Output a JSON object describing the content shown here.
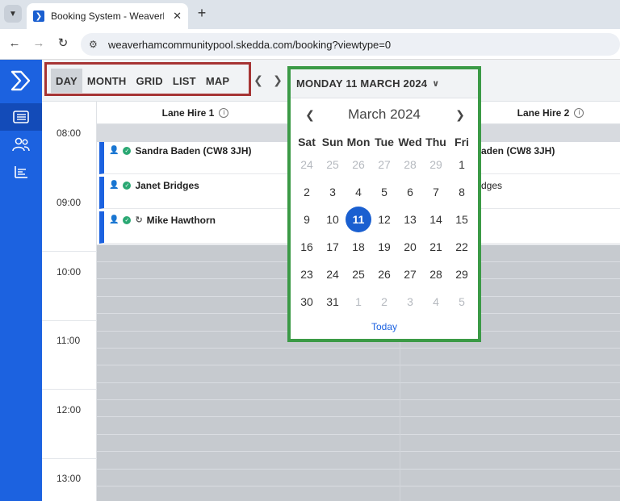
{
  "browser": {
    "tab_title": "Booking System - Weaverham C",
    "url": "weaverhamcommunitypool.skedda.com/booking?viewtype=0"
  },
  "toolbar": {
    "views": [
      {
        "label": "DAY",
        "active": true
      },
      {
        "label": "MONTH",
        "active": false
      },
      {
        "label": "GRID",
        "active": false
      },
      {
        "label": "LIST",
        "active": false
      },
      {
        "label": "MAP",
        "active": false
      }
    ],
    "date_label": "MONDAY 11 MARCH 2024"
  },
  "columns": [
    {
      "label": "Lane Hire 1"
    },
    {
      "label": "Lane Hire 2"
    }
  ],
  "times": [
    "08:00",
    "09:00",
    "10:00",
    "11:00",
    "12:00",
    "13:00"
  ],
  "bookings_lane1": [
    {
      "name": "Sandra Baden (CW8 3JH)",
      "recurring": false
    },
    {
      "name": "Janet Bridges",
      "recurring": false
    },
    {
      "name": "Mike Hawthorn",
      "recurring": true
    }
  ],
  "bookings_lane2_visible": [
    {
      "name": "aden (CW8 3JH)"
    },
    {
      "name": "dges"
    }
  ],
  "calendar": {
    "month_label": "March 2024",
    "days_of_week": [
      "Sat",
      "Sun",
      "Mon",
      "Tue",
      "Wed",
      "Thu",
      "Fri"
    ],
    "weeks": [
      [
        {
          "d": "24",
          "out": true
        },
        {
          "d": "25",
          "out": true
        },
        {
          "d": "26",
          "out": true
        },
        {
          "d": "27",
          "out": true
        },
        {
          "d": "28",
          "out": true
        },
        {
          "d": "29",
          "out": true
        },
        {
          "d": "1",
          "out": false
        }
      ],
      [
        {
          "d": "2"
        },
        {
          "d": "3"
        },
        {
          "d": "4"
        },
        {
          "d": "5"
        },
        {
          "d": "6"
        },
        {
          "d": "7"
        },
        {
          "d": "8"
        }
      ],
      [
        {
          "d": "9"
        },
        {
          "d": "10"
        },
        {
          "d": "11",
          "sel": true
        },
        {
          "d": "12"
        },
        {
          "d": "13"
        },
        {
          "d": "14"
        },
        {
          "d": "15"
        }
      ],
      [
        {
          "d": "16"
        },
        {
          "d": "17"
        },
        {
          "d": "18"
        },
        {
          "d": "19"
        },
        {
          "d": "20"
        },
        {
          "d": "21"
        },
        {
          "d": "22"
        }
      ],
      [
        {
          "d": "23"
        },
        {
          "d": "24"
        },
        {
          "d": "25"
        },
        {
          "d": "26"
        },
        {
          "d": "27"
        },
        {
          "d": "28"
        },
        {
          "d": "29"
        }
      ],
      [
        {
          "d": "30"
        },
        {
          "d": "31"
        },
        {
          "d": "1",
          "out": true
        },
        {
          "d": "2",
          "out": true
        },
        {
          "d": "3",
          "out": true
        },
        {
          "d": "4",
          "out": true
        },
        {
          "d": "5",
          "out": true
        }
      ]
    ],
    "today_label": "Today"
  },
  "colors": {
    "brand": "#1c62e0",
    "selected_day": "#1a5fd0",
    "confirmed": "#2aa873",
    "highlight_red": "#a63434",
    "highlight_green": "#3b9a46"
  }
}
